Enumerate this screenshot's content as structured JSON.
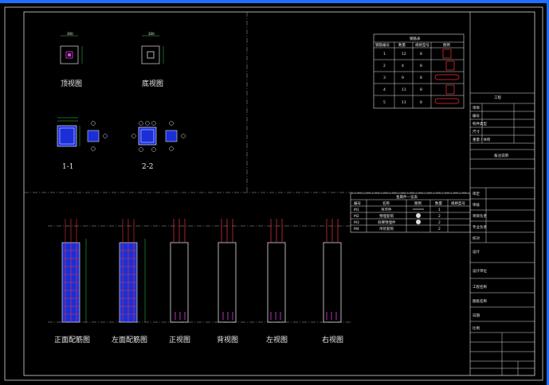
{
  "views": {
    "top": "顶视图",
    "bottom": "底视图",
    "sec1": "1-1",
    "sec2": "2-2",
    "front_rebar": "正面配筋图",
    "left_rebar": "左面配筋图",
    "front": "正视图",
    "back": "背视图",
    "left": "左视图",
    "right": "右视图"
  },
  "rebar_table": {
    "title": "钢筋表",
    "headers": [
      "钢筋编号",
      "数量",
      "规格型号",
      "图例"
    ],
    "rows": [
      [
        "1",
        "12",
        "8",
        ""
      ],
      [
        "2",
        "4",
        "8",
        ""
      ],
      [
        "3",
        "9",
        "8",
        ""
      ],
      [
        "4",
        "11",
        "8",
        ""
      ],
      [
        "5",
        "11",
        "8",
        ""
      ]
    ]
  },
  "embed_table": {
    "title": "金属件一览表",
    "headers": [
      "编号",
      "名称",
      "图例",
      "数量",
      "规格型号"
    ],
    "rows": [
      [
        "M1",
        "吊环件",
        "",
        "1",
        ""
      ],
      [
        "M2",
        "预埋套筒",
        "",
        "2",
        ""
      ],
      [
        "M3",
        "斜撑预埋件",
        "",
        "2",
        ""
      ],
      [
        "M4",
        "吊装套筒",
        "",
        "2",
        ""
      ]
    ]
  },
  "title_block": {
    "project_label": "工程",
    "rows1": [
      "项目",
      "编号",
      "构件类型",
      "尺寸",
      "重量 / 体积"
    ],
    "notes_header": "备注说明",
    "rows2": [
      "审定",
      "审核",
      "项目负责",
      "专业负责",
      "校对",
      "设计"
    ],
    "design_unit": "设计单位",
    "bottom_rows": [
      "工程名称",
      "图纸名称",
      "日期",
      "比例"
    ]
  }
}
